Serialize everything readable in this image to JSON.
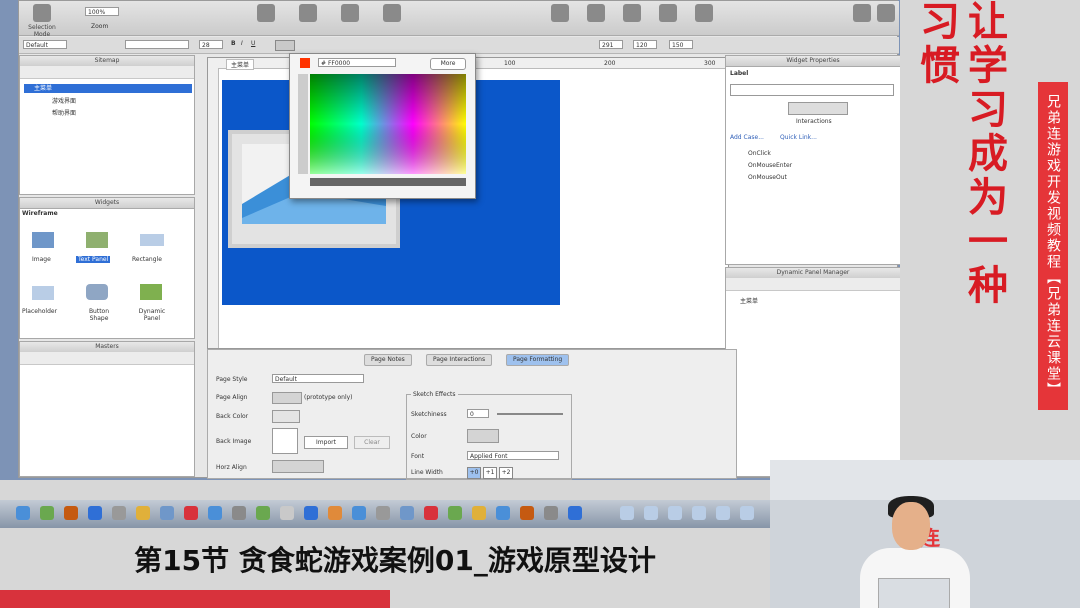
{
  "colors": {
    "accent_red": "#d8323c",
    "canvas_blue": "#0b57c9",
    "selection_blue": "#9ec1ee"
  },
  "toolbar": {
    "selection_mode_label": "Selection Mode",
    "zoom_value": "100%",
    "zoom_label": "Zoom",
    "style_select": "Default",
    "font_size": "28",
    "x_value": "291",
    "y_value": "120",
    "w_value": "150"
  },
  "sitemap": {
    "title": "Sitemap",
    "items": [
      {
        "label": "主菜单"
      },
      {
        "label": "游戏界面"
      },
      {
        "label": "帮助界面"
      }
    ]
  },
  "widgets": {
    "title": "Widgets",
    "library": "Wireframe",
    "items": [
      {
        "label": "Image",
        "icon": "image-icon"
      },
      {
        "label": "Text Panel",
        "icon": "text-panel-icon"
      },
      {
        "label": "Rectangle",
        "icon": "rectangle-icon"
      },
      {
        "label": "Placeholder",
        "icon": "placeholder-icon"
      },
      {
        "label": "Button Shape",
        "icon": "button-shape-icon"
      },
      {
        "label": "Dynamic Panel",
        "icon": "dynamic-panel-icon"
      }
    ]
  },
  "masters": {
    "title": "Masters"
  },
  "canvas": {
    "page_tab": "主菜单",
    "ruler_marks": [
      "100",
      "200",
      "300"
    ]
  },
  "color_picker": {
    "hex_value": "FF0000",
    "more_label": "More"
  },
  "widget_properties": {
    "title": "Widget Properties",
    "label_caption": "Label",
    "interactions_caption": "Interactions",
    "add_case": "Add Case...",
    "quick_link": "Quick Link...",
    "events": [
      "OnClick",
      "OnMouseEnter",
      "OnMouseOut"
    ]
  },
  "dynamic_panel_manager": {
    "title": "Dynamic Panel Manager",
    "item": "主菜单"
  },
  "bottom_panel": {
    "tabs": [
      "Page Notes",
      "Page Interactions",
      "Page Formatting"
    ],
    "page_style_label": "Page Style",
    "page_style_value": "Default",
    "page_align_label": "Page Align",
    "page_align_note": "(prototype only)",
    "back_color_label": "Back Color",
    "back_image_label": "Back Image",
    "import_label": "Import",
    "clear_label": "Clear",
    "horz_align_label": "Horz Align",
    "sketch_effects_title": "Sketch Effects",
    "sketchiness_label": "Sketchiness",
    "sketchiness_value": "0",
    "color_label": "Color",
    "font_label": "Font",
    "font_value": "Applied Font",
    "line_width_label": "Line Width",
    "line_width_options": [
      "+0",
      "+1",
      "+2"
    ]
  },
  "caption": "第15节 贪食蛇游戏案例01_游戏原型设计",
  "motto": "让学习成为一种习惯",
  "banner": "兄弟连游戏开发视频教程【兄弟连云课堂】",
  "webcam_sign": "连"
}
